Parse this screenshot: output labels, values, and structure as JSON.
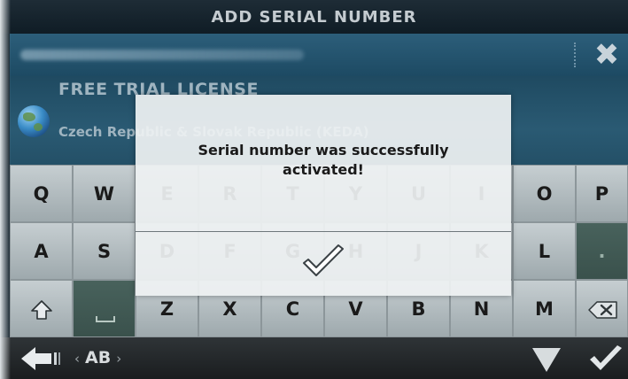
{
  "header": {
    "title": "ADD SERIAL NUMBER"
  },
  "serial_field": {
    "value_obscured": true
  },
  "license": {
    "title": "FREE TRIAL LICENSE",
    "region": "Czech Republic & Slovak Republic  (KEDA)"
  },
  "keyboard": {
    "row1": [
      "Q",
      "W",
      "E",
      "R",
      "T",
      "Y",
      "U",
      "I",
      "O",
      "P"
    ],
    "row2": [
      "A",
      "S",
      "D",
      "F",
      "G",
      "H",
      "J",
      "K",
      "L",
      "."
    ],
    "row3": [
      "Z",
      "X",
      "C",
      "V",
      "B",
      "N",
      "M"
    ]
  },
  "bottom_bar": {
    "layout_label": "AB"
  },
  "dialog": {
    "message_line1": "Serial number was successfully",
    "message_line2": "activated!"
  },
  "colors": {
    "header_bg": "#14232d",
    "serial_bg": "#245267",
    "key_bg": "#b2bcbf",
    "dialog_bg": "#eef1f2"
  },
  "icons": [
    "close-icon",
    "globe-icon",
    "shift-icon",
    "space-icon",
    "backspace-icon",
    "back-arrow-icon",
    "chevron-left-icon",
    "chevron-right-icon",
    "down-triangle-icon",
    "checkmark-icon"
  ]
}
